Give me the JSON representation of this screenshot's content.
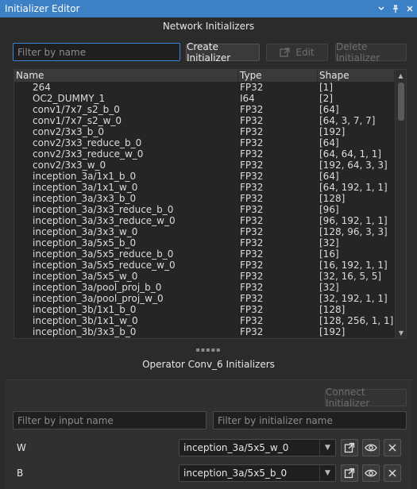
{
  "window": {
    "title": "Initializer Editor",
    "float_icon": "float-window-icon",
    "pin_icon": "pin-icon",
    "close_icon": "close-icon"
  },
  "network": {
    "heading": "Network Initializers",
    "filter_placeholder": "Filter by name",
    "create_label": "Create Initializer",
    "edit_label": "Edit",
    "delete_label": "Delete Initializer",
    "columns": [
      "Name",
      "Type",
      "Shape"
    ],
    "rows": [
      {
        "name": "264",
        "type": "FP32",
        "shape": "[1]"
      },
      {
        "name": "OC2_DUMMY_1",
        "type": "I64",
        "shape": "[2]"
      },
      {
        "name": "conv1/7x7_s2_b_0",
        "type": "FP32",
        "shape": "[64]"
      },
      {
        "name": "conv1/7x7_s2_w_0",
        "type": "FP32",
        "shape": "[64, 3, 7, 7]"
      },
      {
        "name": "conv2/3x3_b_0",
        "type": "FP32",
        "shape": "[192]"
      },
      {
        "name": "conv2/3x3_reduce_b_0",
        "type": "FP32",
        "shape": "[64]"
      },
      {
        "name": "conv2/3x3_reduce_w_0",
        "type": "FP32",
        "shape": "[64, 64, 1, 1]"
      },
      {
        "name": "conv2/3x3_w_0",
        "type": "FP32",
        "shape": "[192, 64, 3, 3]"
      },
      {
        "name": "inception_3a/1x1_b_0",
        "type": "FP32",
        "shape": "[64]"
      },
      {
        "name": "inception_3a/1x1_w_0",
        "type": "FP32",
        "shape": "[64, 192, 1, 1]"
      },
      {
        "name": "inception_3a/3x3_b_0",
        "type": "FP32",
        "shape": "[128]"
      },
      {
        "name": "inception_3a/3x3_reduce_b_0",
        "type": "FP32",
        "shape": "[96]"
      },
      {
        "name": "inception_3a/3x3_reduce_w_0",
        "type": "FP32",
        "shape": "[96, 192, 1, 1]"
      },
      {
        "name": "inception_3a/3x3_w_0",
        "type": "FP32",
        "shape": "[128, 96, 3, 3]"
      },
      {
        "name": "inception_3a/5x5_b_0",
        "type": "FP32",
        "shape": "[32]"
      },
      {
        "name": "inception_3a/5x5_reduce_b_0",
        "type": "FP32",
        "shape": "[16]"
      },
      {
        "name": "inception_3a/5x5_reduce_w_0",
        "type": "FP32",
        "shape": "[16, 192, 1, 1]"
      },
      {
        "name": "inception_3a/5x5_w_0",
        "type": "FP32",
        "shape": "[32, 16, 5, 5]"
      },
      {
        "name": "inception_3a/pool_proj_b_0",
        "type": "FP32",
        "shape": "[32]"
      },
      {
        "name": "inception_3a/pool_proj_w_0",
        "type": "FP32",
        "shape": "[32, 192, 1, 1]"
      },
      {
        "name": "inception_3b/1x1_b_0",
        "type": "FP32",
        "shape": "[128]"
      },
      {
        "name": "inception_3b/1x1_w_0",
        "type": "FP32",
        "shape": "[128, 256, 1, 1]"
      },
      {
        "name": "inception_3b/3x3_b_0",
        "type": "FP32",
        "shape": "[192]"
      }
    ]
  },
  "operator": {
    "heading": "Operator Conv_6 Initializers",
    "connect_label": "Connect Initializer",
    "input_filter_placeholder": "Filter by input name",
    "init_filter_placeholder": "Filter by initializer name",
    "slots": [
      {
        "label": "W",
        "value": "inception_3a/5x5_w_0"
      },
      {
        "label": "B",
        "value": "inception_3a/5x5_b_0"
      }
    ]
  }
}
